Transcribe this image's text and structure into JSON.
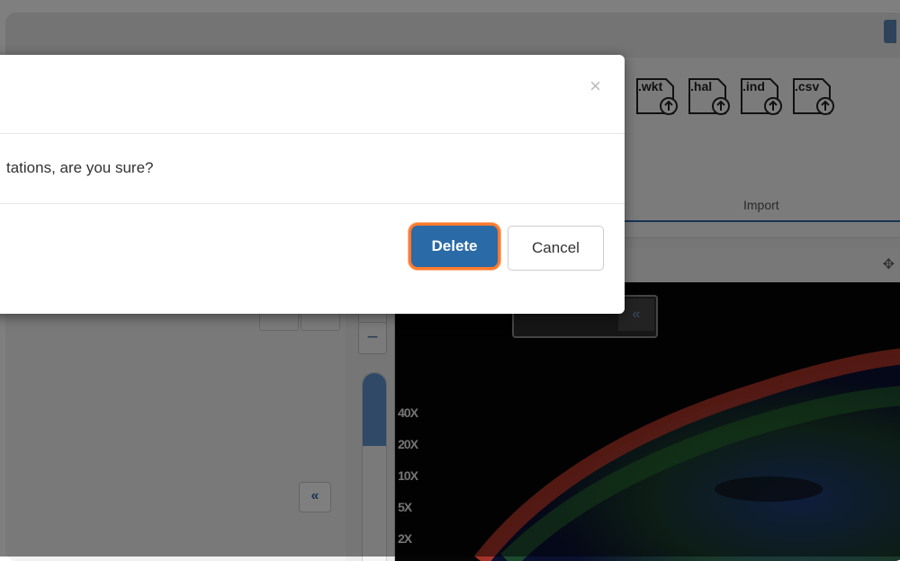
{
  "ribbon": {
    "import_files": [
      {
        "ext": ".wkt",
        "icon": "wkt-file-upload-icon"
      },
      {
        "ext": ".hal",
        "icon": "hal-file-upload-icon"
      },
      {
        "ext": ".ind",
        "icon": "ind-file-upload-icon"
      },
      {
        "ext": ".csv",
        "icon": "csv-file-upload-icon"
      }
    ],
    "group_label": "Import"
  },
  "viewer": {
    "zoom_levels": [
      "40X",
      "20X",
      "10X",
      "5X",
      "2X"
    ],
    "zoom_minus": "−",
    "collapse_label": "«",
    "zoom_slider_level": 0.37
  },
  "modal": {
    "close_label": "×",
    "message": "tations, are you sure?",
    "delete_label": "Delete",
    "cancel_label": "Cancel"
  },
  "colors": {
    "primary": "#2a6aa7",
    "focus_ring": "#ff7a2e",
    "overlay": "rgba(0,0,0,0.5)"
  }
}
